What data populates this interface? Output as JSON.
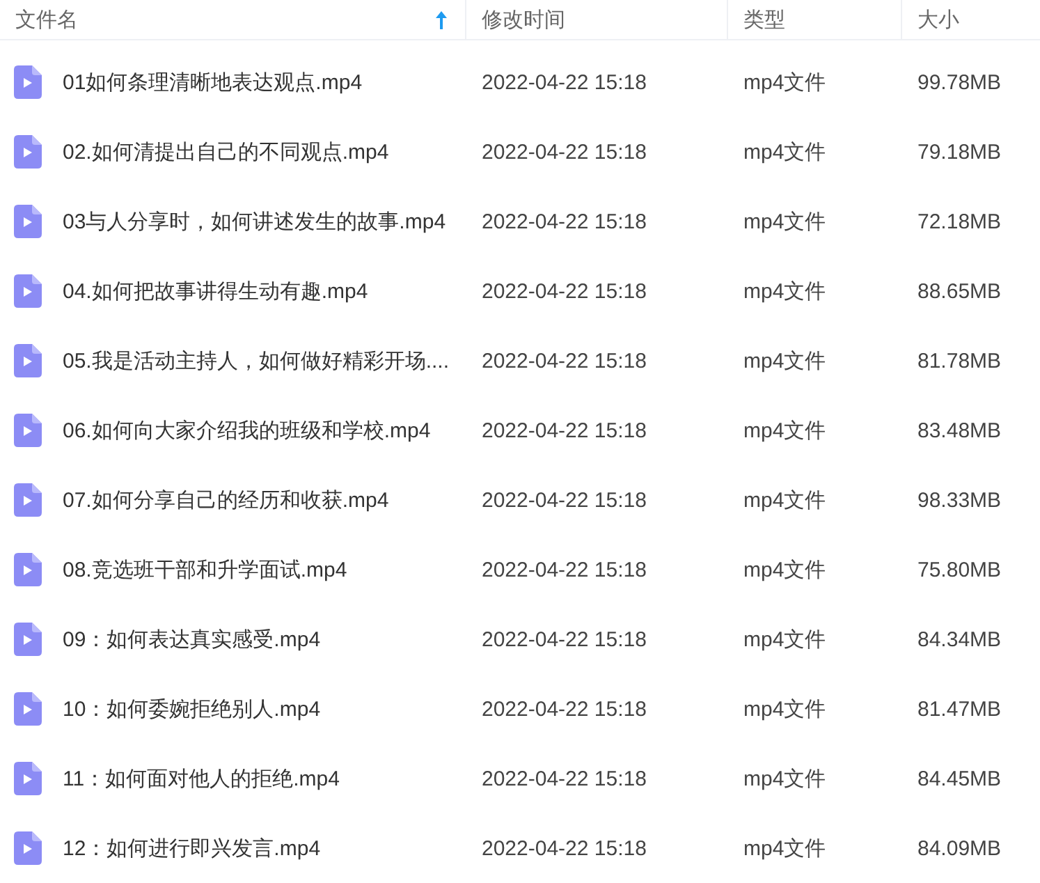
{
  "columns": [
    {
      "label": "文件名",
      "sorted": true
    },
    {
      "label": "修改时间",
      "sorted": false
    },
    {
      "label": "类型",
      "sorted": false
    },
    {
      "label": "大小",
      "sorted": false
    }
  ],
  "rows": [
    {
      "name": "01如何条理清晰地表达观点.mp4",
      "modified": "2022-04-22 15:18",
      "type": "mp4文件",
      "size": "99.78MB"
    },
    {
      "name": "02.如何清提出自己的不同观点.mp4",
      "modified": "2022-04-22 15:18",
      "type": "mp4文件",
      "size": "79.18MB"
    },
    {
      "name": "03与人分享时，如何讲述发生的故事.mp4",
      "modified": "2022-04-22 15:18",
      "type": "mp4文件",
      "size": "72.18MB"
    },
    {
      "name": "04.如何把故事讲得生动有趣.mp4",
      "modified": "2022-04-22 15:18",
      "type": "mp4文件",
      "size": "88.65MB"
    },
    {
      "name": "05.我是活动主持人，如何做好精彩开场....",
      "modified": "2022-04-22 15:18",
      "type": "mp4文件",
      "size": "81.78MB"
    },
    {
      "name": "06.如何向大家介绍我的班级和学校.mp4",
      "modified": "2022-04-22 15:18",
      "type": "mp4文件",
      "size": "83.48MB"
    },
    {
      "name": "07.如何分享自己的经历和收获.mp4",
      "modified": "2022-04-22 15:18",
      "type": "mp4文件",
      "size": "98.33MB"
    },
    {
      "name": "08.竞选班干部和升学面试.mp4",
      "modified": "2022-04-22 15:18",
      "type": "mp4文件",
      "size": "75.80MB"
    },
    {
      "name": "09：如何表达真实感受.mp4",
      "modified": "2022-04-22 15:18",
      "type": "mp4文件",
      "size": "84.34MB"
    },
    {
      "name": "10：如何委婉拒绝别人.mp4",
      "modified": "2022-04-22 15:18",
      "type": "mp4文件",
      "size": "81.47MB"
    },
    {
      "name": "11：如何面对他人的拒绝.mp4",
      "modified": "2022-04-22 15:18",
      "type": "mp4文件",
      "size": "84.45MB"
    },
    {
      "name": "12：如何进行即兴发言.mp4",
      "modified": "2022-04-22 15:18",
      "type": "mp4文件",
      "size": "84.09MB"
    }
  ]
}
